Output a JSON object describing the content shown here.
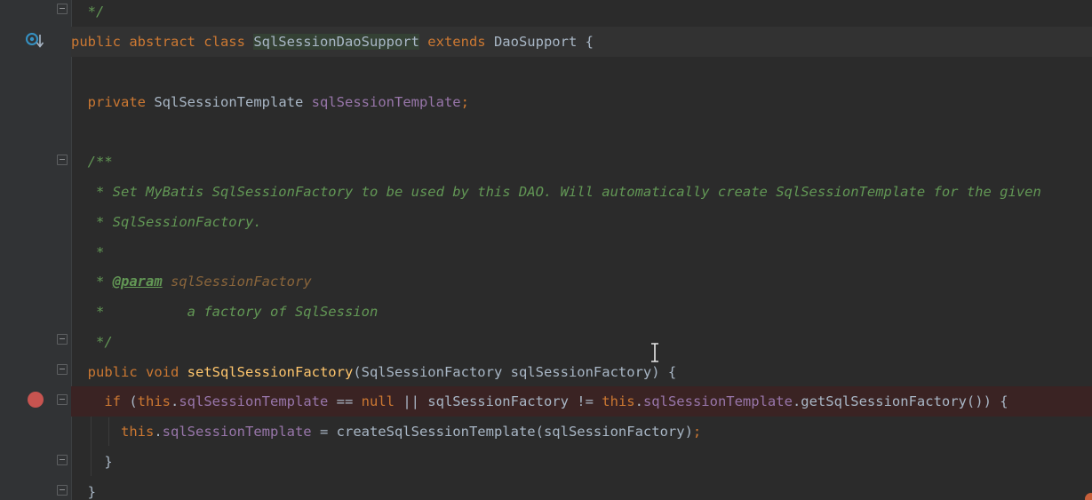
{
  "editor": {
    "colors": {
      "background": "#2b2b2b",
      "gutter": "#313335",
      "keyword": "#cc7832",
      "field": "#9876aa",
      "method": "#ffc66d",
      "comment": "#629755",
      "breakpoint": "#c75450"
    },
    "lines": {
      "l0": {
        "cmt": "*/"
      },
      "l1": {
        "kw1": "public abstract class",
        "cls": "SqlSessionDaoSupport",
        "kw2": "extends",
        "rest": "DaoSupport {"
      },
      "l3": {
        "kw": "private",
        "type": "SqlSessionTemplate",
        "fld": "sqlSessionTemplate",
        "semi": ";"
      },
      "l5": {
        "cmt": "/**"
      },
      "l6": {
        "cmt": "* Set MyBatis SqlSessionFactory to be used by this DAO. Will automatically create SqlSessionTemplate for the given"
      },
      "l7": {
        "cmt": "* SqlSessionFactory."
      },
      "l8": {
        "cmt": "*"
      },
      "l9": {
        "star": "* ",
        "tag": "@param",
        "pname": "sqlSessionFactory"
      },
      "l10": {
        "cmt": "*          a factory of SqlSession"
      },
      "l11": {
        "cmt": "*/"
      },
      "l12": {
        "kw": "public void",
        "fn": "setSqlSessionFactory",
        "args": "(SqlSessionFactory sqlSessionFactory) {"
      },
      "l13": {
        "kw1": "if",
        "p1": " (",
        "this1": "this",
        "dot1": ".",
        "fld1": "sqlSessionTemplate",
        "op1": " == ",
        "nul": "null",
        "op2": " || sqlSessionFactory != ",
        "this2": "this",
        "dot2": ".",
        "fld2": "sqlSessionTemplate",
        "rest": ".getSqlSessionFactory()) {"
      },
      "l14": {
        "this1": "this",
        "dot": ".",
        "fld": "sqlSessionTemplate",
        "rest": " = createSqlSessionTemplate(sqlSessionFactory)",
        "semi": ";"
      },
      "l15": {
        "brace": "}"
      },
      "l16": {
        "brace": "}"
      }
    }
  }
}
